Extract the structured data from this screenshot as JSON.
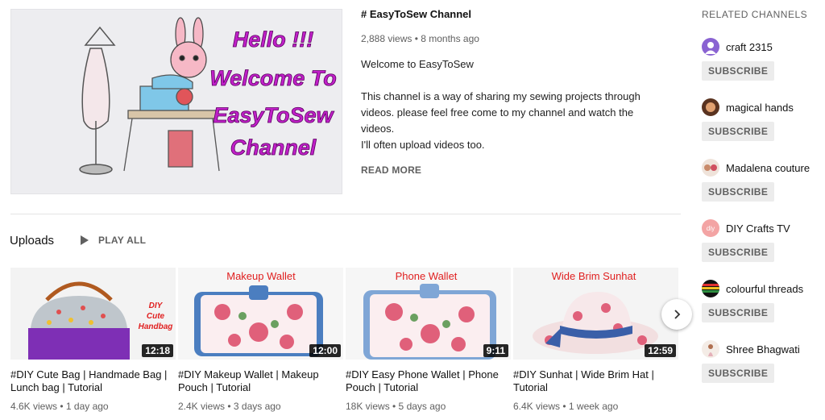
{
  "featured": {
    "thumb_lines": [
      "Hello !!!",
      "Welcome To",
      "EasyToSew",
      "Channel"
    ],
    "title": "# EasyToSew Channel",
    "meta": "2,888 views • 8 months ago",
    "description": "Welcome  to  EasyToSew\n\nThis channel is a way of sharing my sewing projects through videos.  please feel free come to my channel and watch the videos.\nI'll often upload videos too.",
    "read_more": "READ MORE"
  },
  "uploads": {
    "title": "Uploads",
    "play_all": "PLAY ALL",
    "videos": [
      {
        "thumb_text": [
          "DIY",
          "Cute",
          "Handbag"
        ],
        "duration": "12:18",
        "title": "#DIY Cute Bag | Handmade Bag | Lunch bag | Tutorial",
        "meta": "4.6K views • 1 day ago"
      },
      {
        "thumb_text": [
          "Makeup Wallet"
        ],
        "duration": "12:00",
        "title": "#DIY Makeup Wallet | Makeup Pouch | Tutorial",
        "meta": "2.4K views • 3 days ago"
      },
      {
        "thumb_text": [
          "Phone Wallet"
        ],
        "duration": "9:11",
        "title": "#DIY Easy Phone Wallet | Phone Pouch | Tutorial",
        "meta": "18K views • 5 days ago"
      },
      {
        "thumb_text": [
          "Wide Brim Sunhat"
        ],
        "duration": "12:59",
        "title": "#DIY Sunhat | Wide Brim Hat | Tutorial",
        "meta": "6.4K views • 1 week ago"
      }
    ]
  },
  "related": {
    "heading": "RELATED CHANNELS",
    "subscribe_label": "SUBSCRIBE",
    "channels": [
      {
        "name": "craft 2315",
        "avatar_color": "#8a63d2"
      },
      {
        "name": "magical hands",
        "avatar_color": "#5a3320"
      },
      {
        "name": "Madalena couture",
        "avatar_color": "#c98a6a"
      },
      {
        "name": "DIY Crafts TV",
        "avatar_color": "#f3a4a4"
      },
      {
        "name": "colourful threads",
        "avatar_color": "#2f8f3f"
      },
      {
        "name": "Shree Bhagwati",
        "avatar_color": "#e6d6cc"
      }
    ]
  },
  "colors": {
    "magenta_text": "#c020c8",
    "thumb_title_red": "#e02020",
    "meta_gray": "#606060"
  }
}
